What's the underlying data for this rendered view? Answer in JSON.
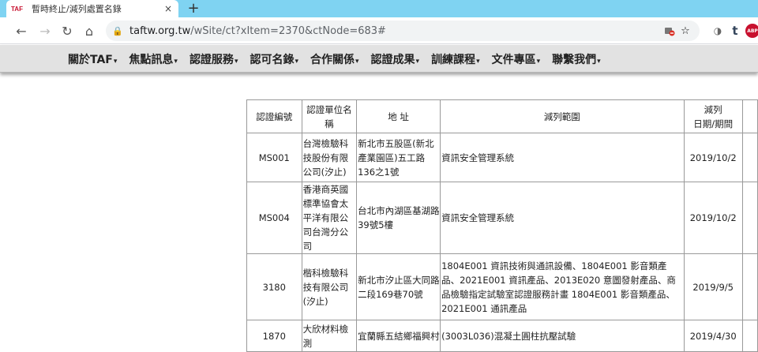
{
  "tab": {
    "favicon": "TAF",
    "title": "暫時終止/減列處置名錄",
    "close": "×",
    "new_tab": "+"
  },
  "address": {
    "url_domain": "taftw.org.tw",
    "url_path": "/wSite/ct?xItem=2370&ctNode=683#"
  },
  "icons": {
    "back": "←",
    "forward": "→",
    "reload": "↻",
    "home": "⌂",
    "lock": "🔒",
    "star": "☆"
  },
  "extensions": [
    "◑",
    "t",
    "ABP"
  ],
  "nav": {
    "items": [
      "關於TAF",
      "焦點訊息",
      "認證服務",
      "認可名錄",
      "合作關係",
      "認證成果",
      "訓練課程",
      "文件專區",
      "聯繫我們"
    ]
  },
  "table": {
    "headers": [
      "認證編號",
      "認證單位名稱",
      "地 址",
      "減列範圍",
      "減列\n日期/期間"
    ],
    "rows": [
      {
        "id": "MS001",
        "name": "台灣檢驗科技股份有限公司(汐止)",
        "address": "新北市五股區(新北產業園區)五工路136之1號",
        "scope": "資訊安全管理系統",
        "date": "2019/10/2"
      },
      {
        "id": "MS004",
        "name": "香港商英國標準協會太平洋有限公司台灣分公司",
        "address": "台北市內湖區基湖路39號5樓",
        "scope": "資訊安全管理系統",
        "date": "2019/10/2"
      },
      {
        "id": "3180",
        "name": "楷科檢驗科技有限公司(汐止)",
        "address": "新北市汐止區大同路二段169巷70號",
        "scope": "1804E001 資訊技術與通訊設備、1804E001 影音類產品、2021E001 資訊產品、2013E020 意圖發射產品、商品檢驗指定試驗室認證服務計畫 1804E001 影音類產品、2021E001 通訊產品",
        "date": "2019/9/5"
      },
      {
        "id": "1870",
        "name": "大欣材料檢測",
        "address": "宜蘭縣五結鄉福興村",
        "scope": "(3003L036)混凝土圓柱抗壓試驗",
        "date": "2019/4/30"
      }
    ]
  }
}
